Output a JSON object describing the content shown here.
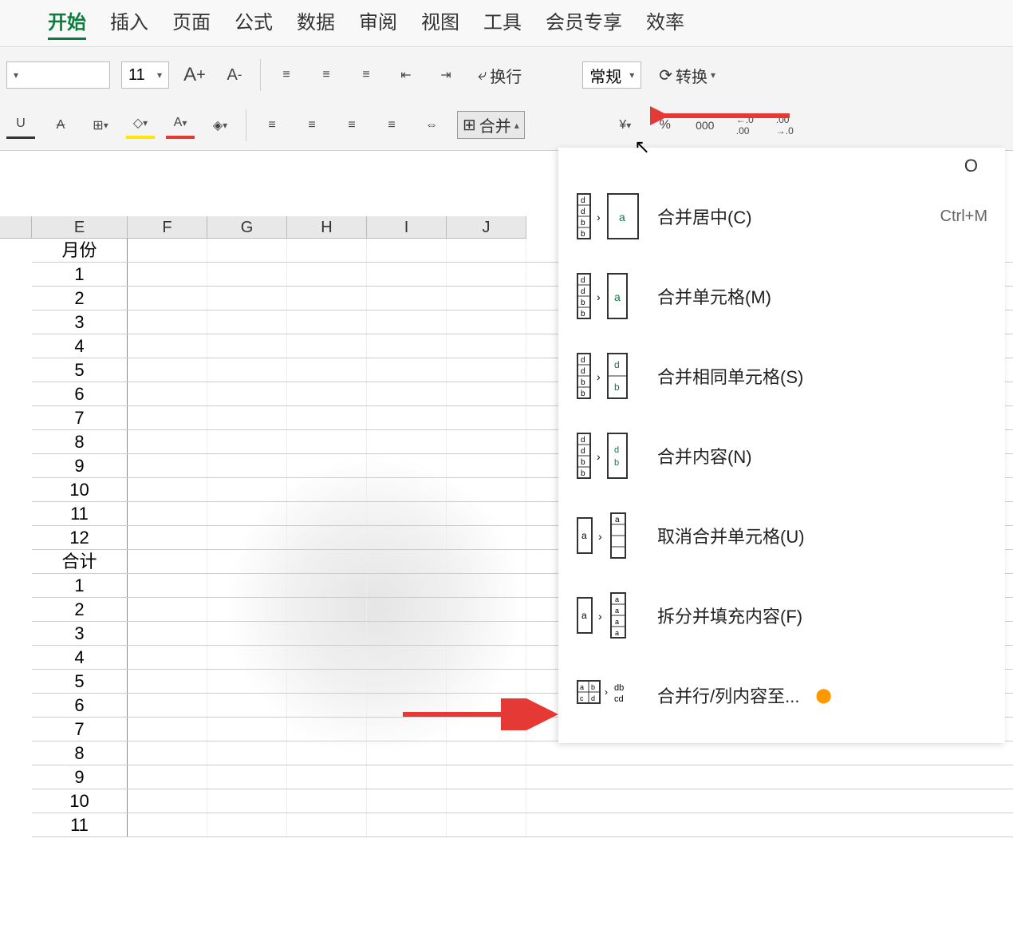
{
  "menubar": {
    "active": "开始",
    "items": [
      "开始",
      "插入",
      "页面",
      "公式",
      "数据",
      "审阅",
      "视图",
      "工具",
      "会员专享",
      "效率"
    ]
  },
  "toolbar": {
    "font_size": "11",
    "increase_font": "A⁺",
    "decrease_font": "A⁻",
    "wrap_label": "换行",
    "merge_label": "合并",
    "number_format": "常规",
    "convert_label": "转换",
    "percent": "%",
    "thousand": "000",
    "dec_inc": "←.0 .00",
    "dec_dec": ".00 →.0"
  },
  "columns": [
    "E",
    "F",
    "G",
    "H",
    "I",
    "J"
  ],
  "cells": {
    "header_e": "月份",
    "group1": [
      "1",
      "2",
      "3",
      "4",
      "5",
      "6",
      "7",
      "8",
      "9",
      "10",
      "11",
      "12"
    ],
    "header2": "合计",
    "group2": [
      "1",
      "2",
      "3",
      "4",
      "5",
      "6",
      "7",
      "8",
      "9",
      "10",
      "11"
    ]
  },
  "merge_menu": {
    "items": [
      {
        "label": "合并居中(C)",
        "shortcut": "Ctrl+M"
      },
      {
        "label": "合并单元格(M)",
        "shortcut": ""
      },
      {
        "label": "合并相同单元格(S)",
        "shortcut": ""
      },
      {
        "label": "合并内容(N)",
        "shortcut": ""
      },
      {
        "label": "取消合并单元格(U)",
        "shortcut": ""
      },
      {
        "label": "拆分并填充内容(F)",
        "shortcut": ""
      },
      {
        "label": "合并行/列内容至...",
        "shortcut": ""
      }
    ]
  },
  "dropdown_col": "O"
}
